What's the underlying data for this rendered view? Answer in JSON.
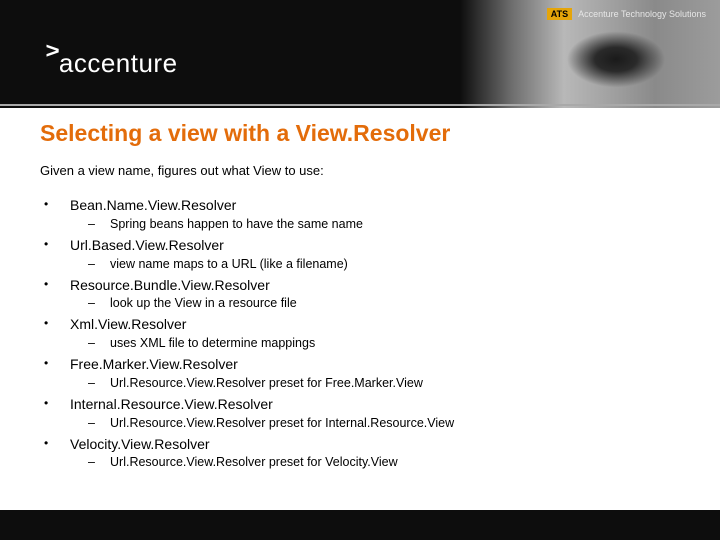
{
  "brand": {
    "logo_mark": ">",
    "logo_text": "accenture",
    "ats_badge": "ATS",
    "ats_text": "Accenture Technology Solutions"
  },
  "slide": {
    "title": "Selecting a view with a View.Resolver",
    "intro": "Given a view name, figures out what View to use:",
    "items": [
      {
        "label": "Bean.Name.View.Resolver",
        "sub": "Spring beans happen to have the same name"
      },
      {
        "label": "Url.Based.View.Resolver",
        "sub": "view name maps to a URL (like a filename)"
      },
      {
        "label": "Resource.Bundle.View.Resolver",
        "sub": "look up the View in a resource file"
      },
      {
        "label": "Xml.View.Resolver",
        "sub": "uses XML file to determine mappings"
      },
      {
        "label": "Free.Marker.View.Resolver",
        "sub": "Url.Resource.View.Resolver preset for Free.Marker.View"
      },
      {
        "label": "Internal.Resource.View.Resolver",
        "sub": "Url.Resource.View.Resolver preset for Internal.Resource.View"
      },
      {
        "label": "Velocity.View.Resolver",
        "sub": "Url.Resource.View.Resolver preset for Velocity.View"
      }
    ]
  }
}
